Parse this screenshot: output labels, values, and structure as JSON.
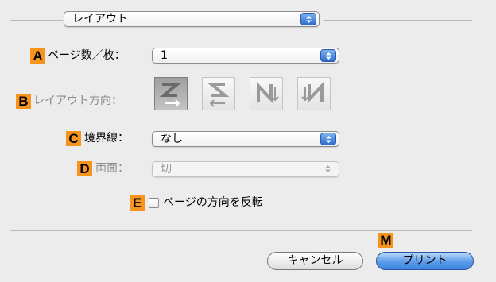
{
  "header": {
    "layout_popup_value": "レイアウト"
  },
  "row_a": {
    "badge": "A",
    "label": "ページ数／枚：",
    "value": "1"
  },
  "row_b": {
    "badge": "B",
    "label": "レイアウト方向：",
    "options": [
      {
        "icon": "z-layout-icon"
      },
      {
        "icon": "reverse-z-layout-icon"
      },
      {
        "icon": "n-layout-icon"
      },
      {
        "icon": "reverse-n-layout-icon"
      }
    ]
  },
  "row_c": {
    "badge": "C",
    "label": "境界線：",
    "value": "なし"
  },
  "row_d": {
    "badge": "D",
    "label": "両面：",
    "value": "切"
  },
  "row_e": {
    "badge": "E",
    "checkbox_label": "ページの方向を反転",
    "checked": false
  },
  "footer": {
    "badge": "M",
    "cancel_label": "キャンセル",
    "print_label": "プリント"
  },
  "colors": {
    "badge": "#f7941d",
    "accent": "#3f86e0"
  }
}
